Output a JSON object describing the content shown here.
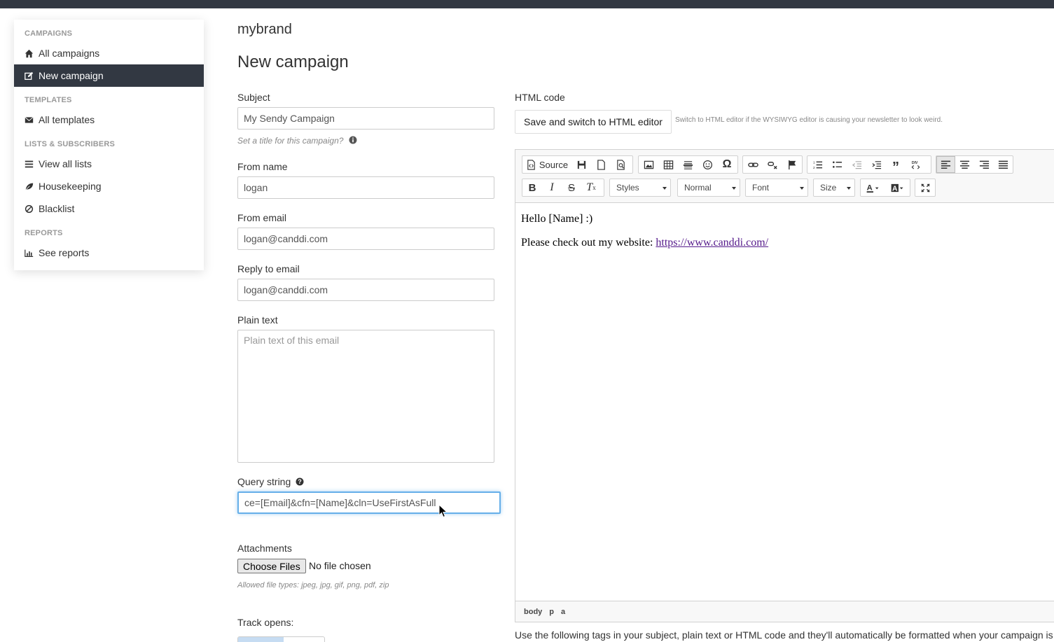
{
  "brand": "mybrand",
  "page_title": "New campaign",
  "sidebar": {
    "sections": [
      {
        "heading": "CAMPAIGNS",
        "items": [
          {
            "label": "All campaigns",
            "icon": "home-icon",
            "active": false
          },
          {
            "label": "New campaign",
            "icon": "edit-icon",
            "active": true
          }
        ]
      },
      {
        "heading": "TEMPLATES",
        "items": [
          {
            "label": "All templates",
            "icon": "envelope-icon",
            "active": false
          }
        ]
      },
      {
        "heading": "LISTS & SUBSCRIBERS",
        "items": [
          {
            "label": "View all lists",
            "icon": "list-icon",
            "active": false
          },
          {
            "label": "Housekeeping",
            "icon": "leaf-icon",
            "active": false
          },
          {
            "label": "Blacklist",
            "icon": "ban-icon",
            "active": false
          }
        ]
      },
      {
        "heading": "REPORTS",
        "items": [
          {
            "label": "See reports",
            "icon": "bar-chart-icon",
            "active": false
          }
        ]
      }
    ]
  },
  "form": {
    "subject": {
      "label": "Subject",
      "value": "My Sendy Campaign",
      "help": "Set a title for this campaign?"
    },
    "from_name": {
      "label": "From name",
      "value": "logan"
    },
    "from_email": {
      "label": "From email",
      "value": "logan@canddi.com"
    },
    "reply_to": {
      "label": "Reply to email",
      "value": "logan@canddi.com"
    },
    "plain_text": {
      "label": "Plain text",
      "placeholder": "Plain text of this email",
      "value": ""
    },
    "query_string": {
      "label": "Query string",
      "value": "ce=[Email]&cfn=[Name]&cln=UseFirstAsFull"
    },
    "attachments": {
      "label": "Attachments",
      "button": "Choose Files",
      "status": "No file chosen",
      "help": "Allowed file types: jpeg, jpg, gif, png, pdf, zip"
    },
    "track_opens": {
      "label": "Track opens:"
    }
  },
  "html_code": {
    "label": "HTML code",
    "switch_button": "Save and switch to HTML editor",
    "switch_note": "Switch to HTML editor if the WYSIWYG editor is causing your newsletter to look weird."
  },
  "editor": {
    "source_label": "Source",
    "styles": "Styles",
    "format": "Normal",
    "font": "Font",
    "size": "Size",
    "content": {
      "greeting": "Hello [Name] :)",
      "text": "Please check out my website: ",
      "link": "https://www.canddi.com/"
    },
    "path": [
      "body",
      "p",
      "a"
    ]
  },
  "tags_note": "Use the following tags in your subject, plain text or HTML code and they'll automatically be formatted when your campaign is",
  "colors": {
    "topbar": "#323842",
    "active_nav": "#323842",
    "focus": "#66afe9",
    "link": "#551a8b"
  }
}
